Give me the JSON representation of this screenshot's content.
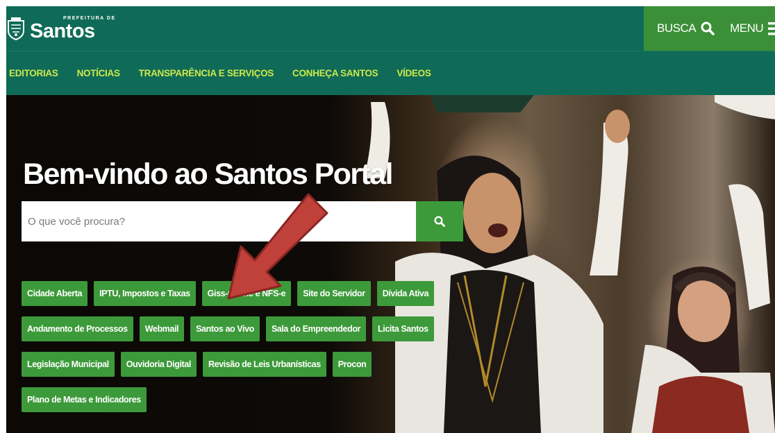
{
  "header": {
    "logo_small": "PREFEITURA DE",
    "logo_big": "Santos",
    "busca_label": "BUSCA",
    "menu_label": "MENU"
  },
  "nav": {
    "items": [
      {
        "label": "EDITORIAS"
      },
      {
        "label": "NOTÍCIAS"
      },
      {
        "label": "TRANSPARÊNCIA E SERVIÇOS"
      },
      {
        "label": "CONHEÇA SANTOS"
      },
      {
        "label": "VÍDEOS"
      }
    ]
  },
  "hero": {
    "title": "Bem-vindo ao Santos Portal",
    "search_placeholder": "O que você procura?"
  },
  "quick_links": {
    "row1": [
      {
        "label": "Cidade Aberta"
      },
      {
        "label": "IPTU, Impostos e Taxas"
      },
      {
        "label": "Giss-Online e NFS-e"
      },
      {
        "label": "Site do Servidor"
      },
      {
        "label": "Dívida Ativa"
      }
    ],
    "row2": [
      {
        "label": "Andamento de Processos"
      },
      {
        "label": "Webmail"
      },
      {
        "label": "Santos ao Vivo"
      },
      {
        "label": "Sala do Empreendedor"
      },
      {
        "label": "Licita Santos"
      }
    ],
    "row3": [
      {
        "label": "Legislação Municipal"
      },
      {
        "label": "Ouvidoria Digital"
      },
      {
        "label": "Revisão de Leis Urbanísticas"
      },
      {
        "label": "Procon"
      }
    ],
    "row4": [
      {
        "label": "Plano de Metas e Indicadores"
      }
    ]
  },
  "icons": {
    "search": "search-icon",
    "menu": "menu-icon",
    "logo": "city-emblem-icon",
    "annotation": "red-arrow-icon"
  },
  "colors": {
    "header_bg": "#0f6b57",
    "nav_text": "#cde84b",
    "accent_green": "#3d9a3a",
    "arrow": "#c0403a"
  }
}
